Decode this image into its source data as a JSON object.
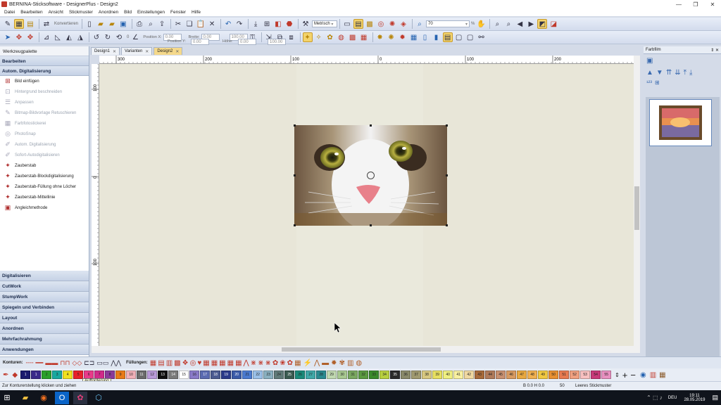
{
  "window": {
    "title": "BERNINA-Sticksoftware - DesignerPlus - Design2"
  },
  "menu": [
    "Datei",
    "Bearbeiten",
    "Ansicht",
    "Stickmuster",
    "Anordnen",
    "Bild",
    "Einstellungen",
    "Fenster",
    "Hilfe"
  ],
  "toolbar1": {
    "convert_label": "Konvertieren",
    "units_value": "Metrisch",
    "zoom_value": "70",
    "zoom_unit": "%"
  },
  "toolbar2": {
    "pos_x_label": "Position X:",
    "pos_x_value": "0.00",
    "pos_y_label": "Position Y:",
    "pos_y_value": "0.00",
    "width_label": "Breite:",
    "width_value": "0.00",
    "width_pct": "100.00",
    "height_label": "Höhe:",
    "height_value": "0.00",
    "height_pct": "100.00",
    "rotate_value": "0"
  },
  "sidebar": {
    "title": "Werkzeugpalette",
    "head_edit": "Bearbeiten",
    "head_autodigi": "Autom. Digitalisierung",
    "items": [
      {
        "label": "Bild einfügen",
        "icon": "insert-image-icon",
        "glyph": "⊞",
        "disabled": false
      },
      {
        "label": "Hintergrund beschneiden",
        "icon": "crop-icon",
        "glyph": "⊡",
        "disabled": true
      },
      {
        "label": "Anpassen",
        "icon": "adjust-icon",
        "glyph": "☰",
        "disabled": true
      },
      {
        "label": "Bitmap-Bildvorlage Retuschieren",
        "icon": "retouch-icon",
        "glyph": "✎",
        "disabled": true
      },
      {
        "label": "Farbfotostickerei",
        "icon": "photo-stitch-icon",
        "glyph": "▦",
        "disabled": true
      },
      {
        "label": "PhotoSnap",
        "icon": "photosnap-icon",
        "glyph": "◎",
        "disabled": true
      },
      {
        "label": "Autom. Digitalisierung",
        "icon": "auto-digitize-icon",
        "glyph": "✐",
        "disabled": true
      },
      {
        "label": "Sofort-Autodigitalisieren",
        "icon": "instant-digitize-icon",
        "glyph": "✐",
        "disabled": true
      },
      {
        "label": "Zauberstab",
        "icon": "magic-wand-icon",
        "glyph": "✦",
        "disabled": false
      },
      {
        "label": "Zauberstab-Blockdigitalisierung",
        "icon": "magic-wand-block-icon",
        "glyph": "✦",
        "disabled": false
      },
      {
        "label": "Zauberstab-Füllung ohne Löcher",
        "icon": "magic-wand-fill-icon",
        "glyph": "✦",
        "disabled": false
      },
      {
        "label": "Zauberstab-Mittellinie",
        "icon": "magic-wand-centerline-icon",
        "glyph": "✦",
        "disabled": false
      },
      {
        "label": "Angleichmethode",
        "icon": "matching-method-icon",
        "glyph": "▣",
        "disabled": false
      }
    ],
    "bottom_heads": [
      "Digitalisieren",
      "CutWork",
      "StumpWork",
      "Spiegeln und Verbinden",
      "Layout",
      "Anordnen",
      "Mehrfachrahmung",
      "Anwendungen"
    ]
  },
  "tabs": [
    {
      "label": "Design1",
      "active": false
    },
    {
      "label": "Varianten",
      "active": false
    },
    {
      "label": "Design2",
      "active": true
    }
  ],
  "ruler": {
    "h_labels": [
      "300",
      "200",
      "100",
      "0",
      "100",
      "200"
    ],
    "v_labels": [
      "100",
      "0",
      "100"
    ]
  },
  "right_panel": {
    "title": "Farbfilm",
    "pin": "⇕ ✕"
  },
  "thread_bar": {
    "konturen_label": "Konturen:",
    "fuellungen_label": "Füllungen:"
  },
  "colors": [
    {
      "n": "1",
      "c": "#1a1a6e"
    },
    {
      "n": "1",
      "c": "#3a2a8a"
    },
    {
      "n": "2",
      "c": "#2aa02a"
    },
    {
      "n": "3",
      "c": "#18a8a0"
    },
    {
      "n": "4",
      "c": "#f0e020"
    },
    {
      "n": "5",
      "c": "#e8202a"
    },
    {
      "n": "6",
      "c": "#e83a8a"
    },
    {
      "n": "7",
      "c": "#d02a8a"
    },
    {
      "n": "8",
      "c": "#8a3a9a"
    },
    {
      "n": "9",
      "c": "#e87a18"
    },
    {
      "n": "10",
      "c": "#f0b0b8"
    },
    {
      "n": "11",
      "c": "#6a6a6a"
    },
    {
      "n": "12",
      "c": "#b89ad8"
    },
    {
      "n": "13",
      "c": "#101010"
    },
    {
      "n": "14",
      "c": "#7a7a7a"
    },
    {
      "n": "15",
      "c": "#ffffff"
    },
    {
      "n": "16",
      "c": "#8a7ac8"
    },
    {
      "n": "17",
      "c": "#5a6ab0"
    },
    {
      "n": "18",
      "c": "#4a5a90"
    },
    {
      "n": "19",
      "c": "#2a3a8a"
    },
    {
      "n": "20",
      "c": "#3a5aa8"
    },
    {
      "n": "21",
      "c": "#4a7ad0"
    },
    {
      "n": "22",
      "c": "#9ac0e8"
    },
    {
      "n": "23",
      "c": "#8ab0c0"
    },
    {
      "n": "24",
      "c": "#607a78"
    },
    {
      "n": "25",
      "c": "#3a5a50"
    },
    {
      "n": "26",
      "c": "#1a8a7a"
    },
    {
      "n": "27",
      "c": "#40a8a8"
    },
    {
      "n": "28",
      "c": "#2a8a90"
    },
    {
      "n": "29",
      "c": "#c0d8b0"
    },
    {
      "n": "30",
      "c": "#a8c890"
    },
    {
      "n": "31",
      "c": "#7aa860"
    },
    {
      "n": "32",
      "c": "#5a9a40"
    },
    {
      "n": "33",
      "c": "#3a8a2a"
    },
    {
      "n": "34",
      "c": "#b8d040"
    },
    {
      "n": "35",
      "c": "#2a2a2a"
    },
    {
      "n": "36",
      "c": "#8a8a6a"
    },
    {
      "n": "37",
      "c": "#a09a70"
    },
    {
      "n": "38",
      "c": "#d8c880"
    },
    {
      "n": "39",
      "c": "#e8e060"
    },
    {
      "n": "40",
      "c": "#f0f080"
    },
    {
      "n": "41",
      "c": "#f8f0a0"
    },
    {
      "n": "42",
      "c": "#f0d8a0"
    },
    {
      "n": "43",
      "c": "#a86a3a"
    },
    {
      "n": "44",
      "c": "#b07a5a"
    },
    {
      "n": "45",
      "c": "#c89070"
    },
    {
      "n": "46",
      "c": "#d89a60"
    },
    {
      "n": "47",
      "c": "#e8a840"
    },
    {
      "n": "48",
      "c": "#f0b050"
    },
    {
      "n": "49",
      "c": "#f0c840"
    },
    {
      "n": "50",
      "c": "#e89030"
    },
    {
      "n": "51",
      "c": "#e87a50"
    },
    {
      "n": "52",
      "c": "#f0a080"
    },
    {
      "n": "53",
      "c": "#f8c0c0"
    },
    {
      "n": "54",
      "c": "#c83a7a"
    },
    {
      "n": "55",
      "c": "#e890c0"
    }
  ],
  "tooltip": "Aufforderung",
  "status": {
    "left": "Zur Konturerstellung klicken und ziehen",
    "coords": "B  0.0 H  0.0",
    "count": "50",
    "pattern": "Leeres Stickmuster"
  },
  "taskbar": {
    "lang": "DEU",
    "time": "19:11",
    "date": "28.05.2019"
  }
}
